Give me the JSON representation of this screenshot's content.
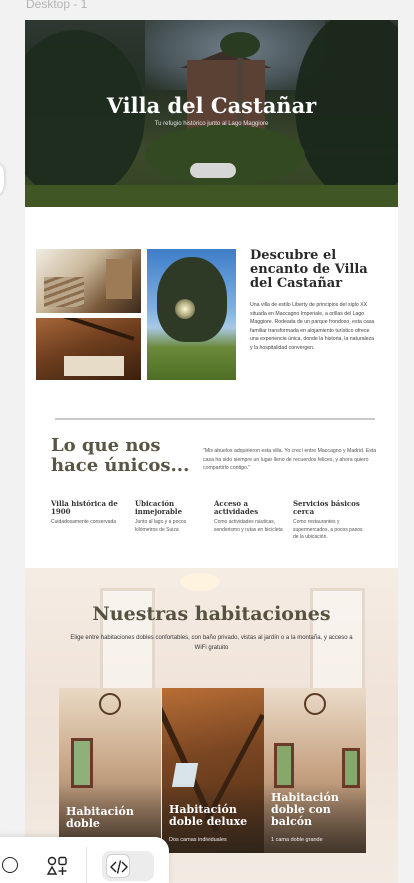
{
  "canvas": {
    "frame_label": "Desktop - 1"
  },
  "hero": {
    "title": "Villa del Castañar",
    "subtitle": "Tu refugio histórico junto al Lago Maggiore",
    "button_label": ""
  },
  "discover": {
    "title": "Descubre el encanto de Villa del Castañar",
    "text": "Una villa de estilo Liberty de principios del siglo XX situada en Maccagno Imperiale, a orillas del Lago Maggiore. Rodeada de un parque frondoso, esta casa familiar transformada en alojamiento turístico ofrece una experiencia única, donde la historia, la naturaleza y la hospitalidad convergen."
  },
  "unique": {
    "title": "Lo que nos hace únicos...",
    "quote": "\"Mis abuelos adquirieron esta villa. Yo crecí entre Maccagno y Madrid. Esta casa ha sido siempre un lugar lleno de recuerdos felices, y ahora quiero compartirlo contigo.\"",
    "features": [
      {
        "title": "Villa histórica de 1900",
        "desc": "Cuidadosamente conservada"
      },
      {
        "title": "Ubicación inmejorable",
        "desc": "Junto al lago y a pocos kilómetros de Suiza"
      },
      {
        "title": "Acceso a actividades",
        "desc": "Como actividades náuticas, senderismo y rutas en bicicleta"
      },
      {
        "title": "Servicios básicos cerca",
        "desc": "Como restaurantes y supermercados, a pocos pasos de la ubicación."
      }
    ]
  },
  "rooms": {
    "title": "Nuestras habitaciones",
    "subtitle": "Elige entre habitaciones dobles confortables, con baño privado, vistas al jardín o a la montaña, y acceso a WiFi gratuito",
    "cards": [
      {
        "name": "Habitación doble",
        "info": ""
      },
      {
        "name": "Habitación doble deluxe",
        "info": "Dos camas individuales"
      },
      {
        "name": "Habitación doble con balcón",
        "info": "1 cama doble grande"
      }
    ]
  },
  "toolbar": {
    "icons": [
      "circle-icon",
      "shapes-icon",
      "code-icon"
    ]
  }
}
